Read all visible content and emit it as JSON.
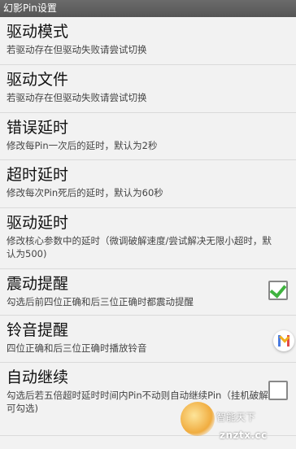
{
  "window": {
    "title": "幻影Pin设置"
  },
  "settings": [
    {
      "title": "驱动模式",
      "summary": "若驱动存在但驱动失败请尝试切换"
    },
    {
      "title": "驱动文件",
      "summary": "若驱动存在但驱动失败请尝试切换"
    },
    {
      "title": "错误延时",
      "summary": "修改每Pin一次后的延时，默认为2秒"
    },
    {
      "title": "超时延时",
      "summary": "修改每次Pin死后的延时，默认为60秒"
    },
    {
      "title": "驱动延时",
      "summary": "修改核心参数中的延时（微调破解速度/尝试解决无限小超时，默认为500)"
    },
    {
      "title": "震动提醒",
      "summary": "勾选后前四位正确和后三位正确时都震动提醒",
      "checked": true
    },
    {
      "title": "铃音提醒",
      "summary": "四位正确和后三位正确时播放铃音"
    },
    {
      "title": "自动继续",
      "summary": "勾选后若五倍超时延时时间内Pin不动则自动继续Pin（挂机破解可勾选)",
      "checked": false
    }
  ],
  "watermark": {
    "top_text": "智能天下",
    "bottom_text": "znztx.cc"
  },
  "colors": {
    "check": "#3fb33f",
    "titlebar": "#5f5f5f",
    "background": "#f2f2f2"
  },
  "icons": {
    "floating": "floating-assistant-icon",
    "watermark": "watermark-logo"
  }
}
